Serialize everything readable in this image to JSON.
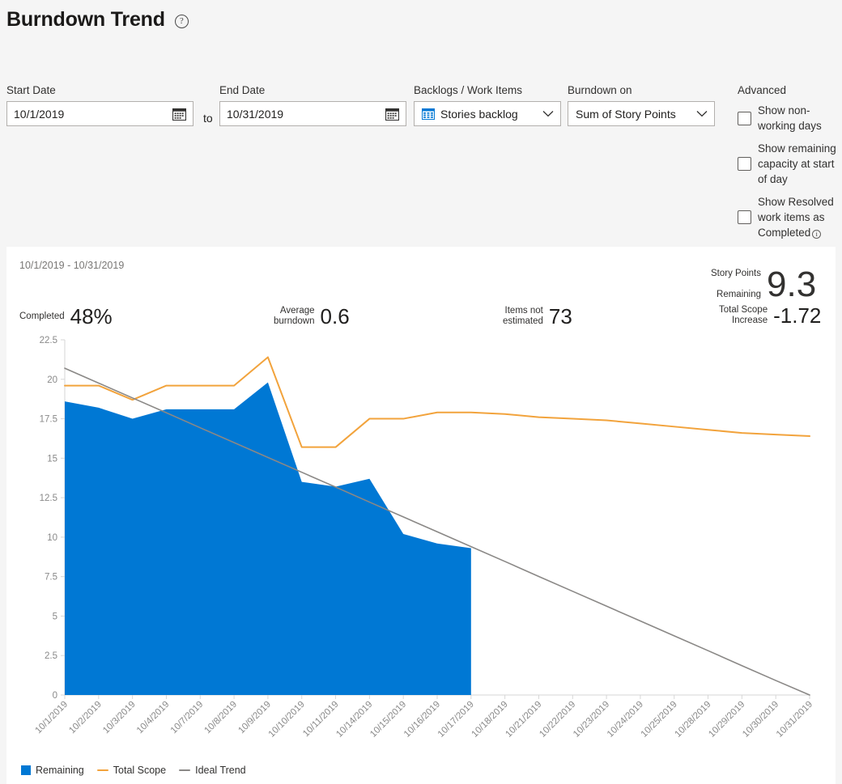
{
  "header": {
    "title": "Burndown Trend",
    "help_icon": "help-circle-icon"
  },
  "toolbar": {
    "start_date": {
      "label": "Start Date",
      "value": "10/1/2019",
      "placeholder": "mm/dd/yyyy",
      "icon": "calendar-icon"
    },
    "separator": "to",
    "end_date": {
      "label": "End Date",
      "value": "10/31/2019",
      "placeholder": "mm/dd/yyyy",
      "icon": "calendar-icon"
    },
    "backlog": {
      "label": "Backlogs / Work Items",
      "value": "Stories backlog",
      "icon": "backlog-icon"
    },
    "burndown_on": {
      "label": "Burndown on",
      "value": "Sum of Story Points"
    },
    "advanced": {
      "label": "Advanced",
      "options": [
        {
          "label": "Show non-working days",
          "checked": false
        },
        {
          "label": "Show remaining capacity at start of day",
          "checked": false
        },
        {
          "label": "Show Resolved work items as Completed",
          "checked": false,
          "info_icon": "info-circle-icon"
        }
      ]
    }
  },
  "card": {
    "date_range": "10/1/2019 - 10/31/2019",
    "kpis": {
      "completed": {
        "label": "Completed",
        "value": "48%"
      },
      "average_burndown": {
        "label": "Average\nburndown",
        "value": "0.6"
      },
      "items_not_estimated": {
        "label": "Items not\nestimated",
        "value": "73"
      },
      "story_points_remaining": {
        "label_line1": "Story Points",
        "label_line2": "Remaining",
        "value": "9.3"
      },
      "total_scope_increase": {
        "label": "Total Scope\nIncrease",
        "value": "-1.72"
      }
    },
    "legend": [
      {
        "name": "Remaining",
        "color": "#0078d4",
        "marker": "box"
      },
      {
        "name": "Total Scope",
        "color": "#f2a33c",
        "marker": "line"
      },
      {
        "name": "Ideal Trend",
        "color": "#8a8886",
        "marker": "line"
      }
    ]
  },
  "chart_data": {
    "type": "area",
    "title": "Burndown Trend",
    "xlabel": "",
    "ylabel": "",
    "ylim": [
      0,
      22.5
    ],
    "yticks": [
      0,
      2.5,
      5,
      7.5,
      10,
      12.5,
      15,
      17.5,
      20,
      22.5
    ],
    "grid": false,
    "legend_position": "bottom-left",
    "categories": [
      "10/1/2019",
      "10/2/2019",
      "10/3/2019",
      "10/4/2019",
      "10/7/2019",
      "10/8/2019",
      "10/9/2019",
      "10/10/2019",
      "10/11/2019",
      "10/14/2019",
      "10/15/2019",
      "10/16/2019",
      "10/17/2019",
      "10/18/2019",
      "10/21/2019",
      "10/22/2019",
      "10/23/2019",
      "10/24/2019",
      "10/25/2019",
      "10/28/2019",
      "10/29/2019",
      "10/30/2019",
      "10/31/2019"
    ],
    "series": [
      {
        "name": "Remaining",
        "type": "area",
        "color": "#0078d4",
        "values": [
          18.6,
          18.2,
          17.5,
          18.1,
          18.1,
          18.1,
          19.8,
          13.5,
          13.2,
          13.7,
          10.2,
          9.6,
          9.3,
          null,
          null,
          null,
          null,
          null,
          null,
          null,
          null,
          null,
          null
        ]
      },
      {
        "name": "Total Scope",
        "type": "line",
        "color": "#f2a33c",
        "values": [
          19.6,
          19.6,
          18.7,
          19.6,
          19.6,
          19.6,
          21.4,
          15.7,
          15.7,
          17.5,
          17.5,
          17.9,
          17.9,
          17.8,
          17.6,
          17.5,
          17.4,
          17.2,
          17.0,
          16.8,
          16.6,
          16.5,
          16.4
        ]
      },
      {
        "name": "Ideal Trend",
        "type": "line",
        "color": "#8a8886",
        "values": [
          20.7,
          19.76,
          18.82,
          17.88,
          16.93,
          15.99,
          15.05,
          14.11,
          13.17,
          12.22,
          11.28,
          10.34,
          9.4,
          8.46,
          7.51,
          6.57,
          5.63,
          4.69,
          3.75,
          2.81,
          1.86,
          0.92,
          0
        ]
      }
    ]
  }
}
